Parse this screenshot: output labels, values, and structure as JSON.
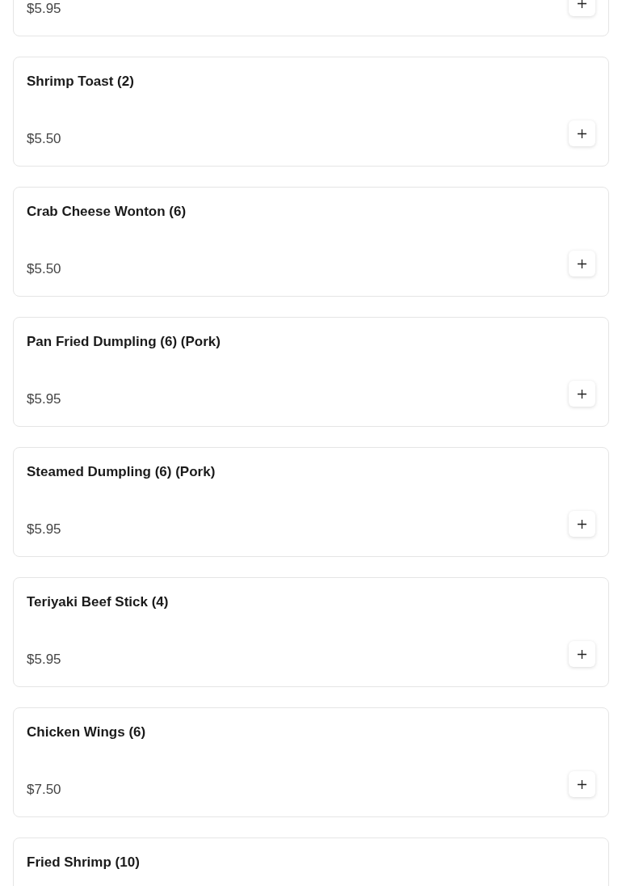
{
  "menu_items": [
    {
      "price": "$5.95"
    },
    {
      "name": "Shrimp Toast (2)",
      "price": "$5.50"
    },
    {
      "name": "Crab Cheese Wonton (6)",
      "price": "$5.50"
    },
    {
      "name": "Pan Fried Dumpling (6) (Pork)",
      "price": "$5.95"
    },
    {
      "name": "Steamed Dumpling (6) (Pork)",
      "price": "$5.95"
    },
    {
      "name": "Teriyaki Beef Stick (4)",
      "price": "$5.95"
    },
    {
      "name": "Chicken Wings (6)",
      "price": "$7.50"
    },
    {
      "name": "Fried Shrimp (10)"
    }
  ]
}
